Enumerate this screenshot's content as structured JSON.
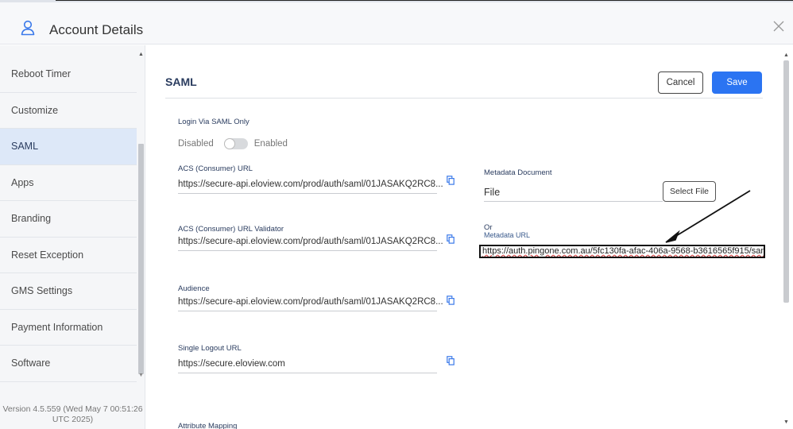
{
  "header": {
    "title": "Account Details",
    "user_icon": "user-icon",
    "close_icon": "close-icon"
  },
  "sidebar": {
    "items": [
      {
        "label": "Reboot Timer"
      },
      {
        "label": "Customize"
      },
      {
        "label": "SAML",
        "active": true
      },
      {
        "label": "Apps"
      },
      {
        "label": "Branding"
      },
      {
        "label": "Reset Exception"
      },
      {
        "label": "GMS Settings"
      },
      {
        "label": "Payment Information"
      },
      {
        "label": "Software"
      }
    ],
    "version_line1": "Version 4.5.559 (Wed May 7 00:51:26",
    "version_line2": "UTC 2025)"
  },
  "main": {
    "title": "SAML",
    "cancel_label": "Cancel",
    "save_label": "Save",
    "accent_color": "#2b74f2",
    "login_saml_only": {
      "label": "Login Via SAML Only",
      "off_label": "Disabled",
      "on_label": "Enabled",
      "enabled": false
    },
    "acs_url": {
      "label": "ACS (Consumer) URL",
      "value": "https://secure-api.eloview.com/prod/auth/saml/01JASAKQ2RC8..."
    },
    "acs_validator": {
      "label": "ACS (Consumer) URL Validator",
      "value": "https://secure-api.eloview.com/prod/auth/saml/01JASAKQ2RC8..."
    },
    "audience": {
      "label": "Audience",
      "value": "https://secure-api.eloview.com/prod/auth/saml/01JASAKQ2RC8..."
    },
    "single_logout": {
      "label": "Single Logout URL",
      "value": "https://secure.eloview.com"
    },
    "attribute_mapping_label": "Attribute Mapping",
    "metadata_document": {
      "label": "Metadata Document",
      "file_value": "File",
      "select_label": "Select File"
    },
    "or_label": "Or",
    "metadata_url": {
      "label": "Metadata URL",
      "value": "https://auth.pingone.com.au/5fc130fa-afac-406a-9568-b3616565f915/sam"
    }
  }
}
